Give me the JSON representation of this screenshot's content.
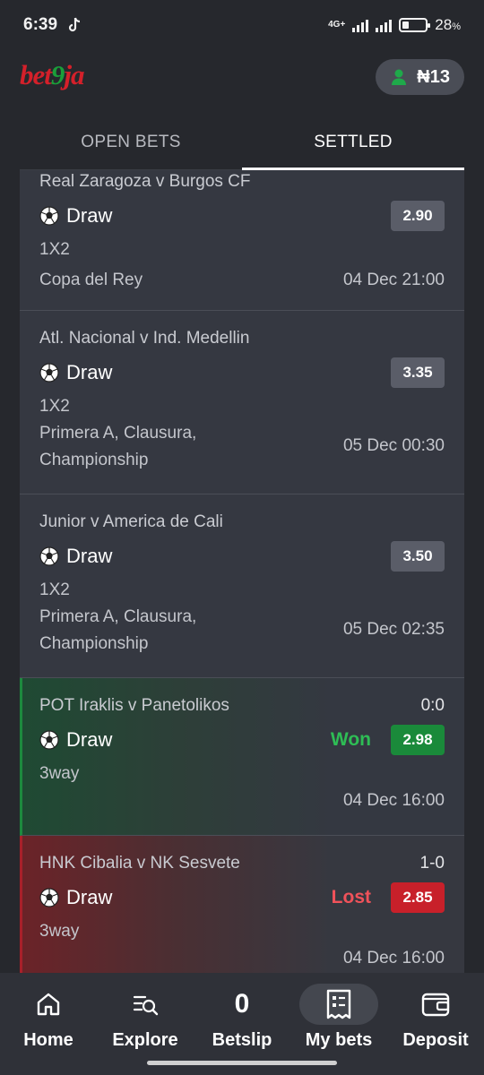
{
  "status_bar": {
    "time": "6:39",
    "network_top": "4G+",
    "battery_percent": "28",
    "battery_unit": "%",
    "battery_level": 0.28
  },
  "header": {
    "logo_part1": "bet",
    "logo_part2": "9",
    "logo_part3": "ja",
    "balance": "₦13"
  },
  "tabs": [
    {
      "label": "OPEN BETS",
      "active": false
    },
    {
      "label": "SETTLED",
      "active": true
    }
  ],
  "bets": [
    {
      "match": "Real Zaragoza v Burgos CF",
      "selection": "Draw",
      "odds": "2.90",
      "market": "1X2",
      "competition": "Copa del Rey",
      "kickoff": "04 Dec 21:00"
    },
    {
      "match": "Atl. Nacional v Ind. Medellin",
      "selection": "Draw",
      "odds": "3.35",
      "market": "1X2",
      "competition_line1": "Primera A, Clausura,",
      "competition_line2": "Championship",
      "kickoff": "05 Dec 00:30"
    },
    {
      "match": "Junior v America de Cali",
      "selection": "Draw",
      "odds": "3.50",
      "market": "1X2",
      "competition_line1": "Primera A, Clausura,",
      "competition_line2": "Championship",
      "kickoff": "05 Dec 02:35"
    },
    {
      "match": "POT Iraklis v Panetolikos",
      "score": "0:0",
      "selection": "Draw",
      "result": "Won",
      "odds": "2.98",
      "market": "3way",
      "kickoff": "04 Dec 16:00"
    },
    {
      "match": "HNK Cibalia v NK Sesvete",
      "score": "1-0",
      "selection": "Draw",
      "result": "Lost",
      "odds": "2.85",
      "market": "3way",
      "kickoff": "04 Dec 16:00"
    }
  ],
  "bottom_nav": [
    {
      "label": "Home",
      "icon": "home-icon"
    },
    {
      "label": "Explore",
      "icon": "explore-icon"
    },
    {
      "label": "Betslip",
      "count": "0"
    },
    {
      "label": "My bets",
      "icon": "my-bets-icon",
      "active": true
    },
    {
      "label": "Deposit",
      "icon": "wallet-icon"
    }
  ],
  "colors": {
    "background": "#26282d",
    "card": "#353841",
    "won": "#1a8a3a",
    "lost": "#c8202a",
    "brand_red": "#d4202a",
    "brand_green": "#1a9f3a"
  }
}
